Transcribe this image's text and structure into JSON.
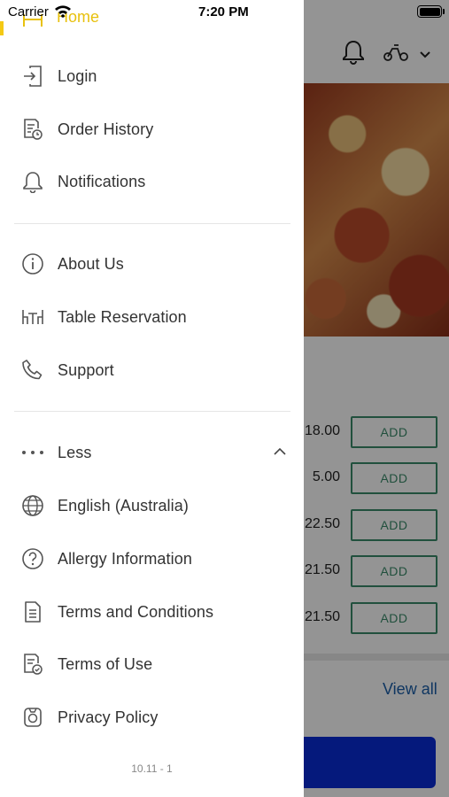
{
  "status_bar": {
    "carrier": "Carrier",
    "time": "7:20 PM"
  },
  "drawer": {
    "home_label": "Home",
    "items_top": [
      {
        "label": "Login",
        "icon": "login-icon"
      },
      {
        "label": "Order History",
        "icon": "order-history-icon"
      },
      {
        "label": "Notifications",
        "icon": "bell-icon"
      }
    ],
    "items_mid": [
      {
        "label": "About Us",
        "icon": "info-icon"
      },
      {
        "label": "Table Reservation",
        "icon": "table-icon"
      },
      {
        "label": "Support",
        "icon": "phone-icon"
      }
    ],
    "less_label": "Less",
    "items_bottom": [
      {
        "label": "English (Australia)",
        "icon": "globe-icon"
      },
      {
        "label": "Allergy Information",
        "icon": "question-icon"
      },
      {
        "label": "Terms and Conditions",
        "icon": "document-icon"
      },
      {
        "label": "Terms of Use",
        "icon": "document-check-icon"
      },
      {
        "label": "Privacy Policy",
        "icon": "privacy-icon"
      }
    ],
    "version": "10.11 - 1"
  },
  "background": {
    "prices": [
      "18.00",
      "5.00",
      "22.50",
      "21.50",
      "21.50"
    ],
    "add_label": "ADD",
    "view_all": "View all"
  },
  "colors": {
    "accent": "#f4c914",
    "primary": "#0a2bd6",
    "add_border": "#3a8a6a"
  }
}
